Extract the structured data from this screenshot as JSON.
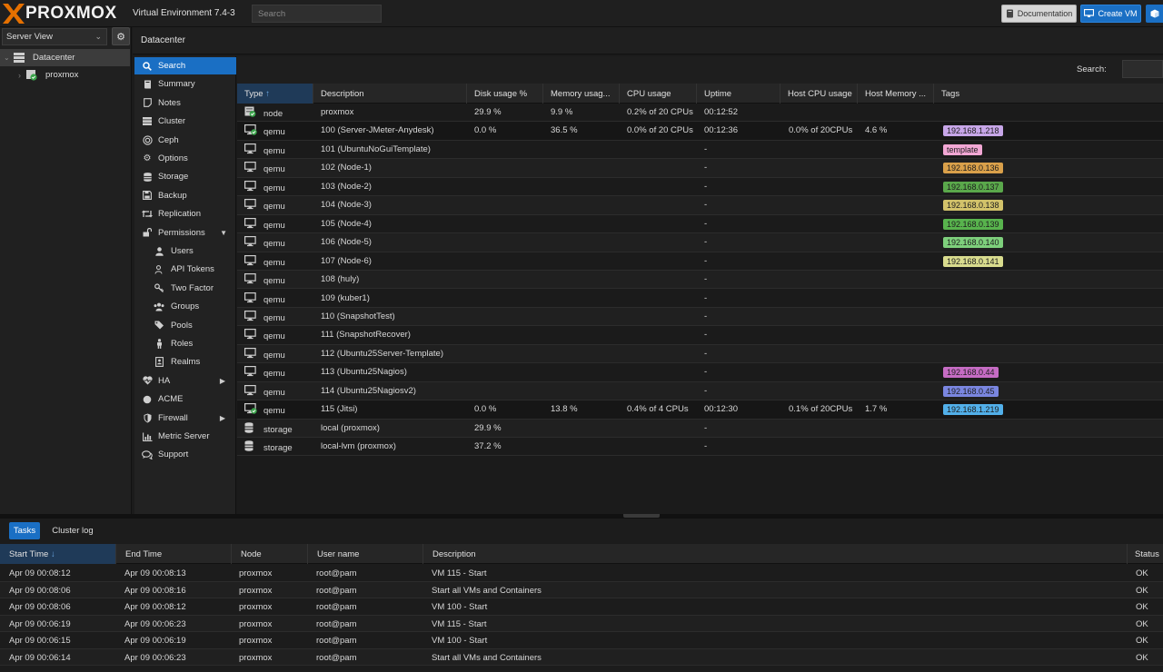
{
  "topbar": {
    "logo": "PROXMOX",
    "version": "Virtual Environment 7.4-3",
    "search_placeholder": "Search",
    "documentation_label": "Documentation",
    "create_vm_label": "Create VM"
  },
  "tree": {
    "view_label": "Server View",
    "items": [
      {
        "label": "Datacenter",
        "icon": "datacenter-icon"
      },
      {
        "label": "proxmox",
        "icon": "node-online-icon"
      }
    ]
  },
  "content_header": {
    "title": "Datacenter"
  },
  "nav": {
    "items": [
      {
        "label": "Search",
        "icon": "search-icon",
        "active": true
      },
      {
        "label": "Summary",
        "icon": "book-icon"
      },
      {
        "label": "Notes",
        "icon": "note-icon"
      },
      {
        "label": "Cluster",
        "icon": "server-icon"
      },
      {
        "label": "Ceph",
        "icon": "ceph-icon"
      },
      {
        "label": "Options",
        "icon": "gear-icon"
      },
      {
        "label": "Storage",
        "icon": "database-icon"
      },
      {
        "label": "Backup",
        "icon": "floppy-icon"
      },
      {
        "label": "Replication",
        "icon": "retweet-icon"
      },
      {
        "label": "Permissions",
        "icon": "unlock-icon",
        "expanded": true
      },
      {
        "label": "Users",
        "icon": "user-icon",
        "sub": true
      },
      {
        "label": "API Tokens",
        "icon": "user-tag-icon",
        "sub": true
      },
      {
        "label": "Two Factor",
        "icon": "key-icon",
        "sub": true
      },
      {
        "label": "Groups",
        "icon": "users-icon",
        "sub": true
      },
      {
        "label": "Pools",
        "icon": "tags-icon",
        "sub": true
      },
      {
        "label": "Roles",
        "icon": "male-icon",
        "sub": true
      },
      {
        "label": "Realms",
        "icon": "address-book-icon",
        "sub": true
      },
      {
        "label": "HA",
        "icon": "heartbeat-icon",
        "collapsed": true
      },
      {
        "label": "ACME",
        "icon": "certificate-icon"
      },
      {
        "label": "Firewall",
        "icon": "shield-icon",
        "collapsed": true
      },
      {
        "label": "Metric Server",
        "icon": "bar-chart-icon"
      },
      {
        "label": "Support",
        "icon": "comments-icon"
      }
    ]
  },
  "grid": {
    "search_label": "Search:",
    "columns": [
      "Type",
      "Description",
      "Disk usage %",
      "Memory usag...",
      "CPU usage",
      "Uptime",
      "Host CPU usage",
      "Host Memory ...",
      "Tags"
    ],
    "rows": [
      {
        "icon": "node-online-icon",
        "type": "node",
        "desc": "proxmox",
        "disk": "29.9 %",
        "mem": "9.9 %",
        "cpu": "0.2% of 20 CPUs",
        "uptime": "00:12:52",
        "hostcpu": "",
        "hostmem": "",
        "tag": ""
      },
      {
        "icon": "vm-running-icon",
        "type": "qemu",
        "desc": "100 (Server-JMeter-Anydesk)",
        "disk": "0.0 %",
        "mem": "36.5 %",
        "cpu": "0.0% of 20 CPUs",
        "uptime": "00:12:36",
        "hostcpu": "0.0% of 20CPUs",
        "hostmem": "4.6 %",
        "tag": "192.168.1.218",
        "tag_color": "#c7a6e8",
        "highlight": true
      },
      {
        "icon": "vm-icon",
        "type": "qemu",
        "desc": "101 (UbuntuNoGuiTemplate)",
        "disk": "",
        "mem": "",
        "cpu": "",
        "uptime": "-",
        "hostcpu": "",
        "hostmem": "",
        "tag": "template",
        "tag_color": "#f2a7d4"
      },
      {
        "icon": "vm-icon",
        "type": "qemu",
        "desc": "102 (Node-1)",
        "disk": "",
        "mem": "",
        "cpu": "",
        "uptime": "-",
        "hostcpu": "",
        "hostmem": "",
        "tag": "192.168.0.136",
        "tag_color": "#d9a04a"
      },
      {
        "icon": "vm-icon",
        "type": "qemu",
        "desc": "103 (Node-2)",
        "disk": "",
        "mem": "",
        "cpu": "",
        "uptime": "-",
        "hostcpu": "",
        "hostmem": "",
        "tag": "192.168.0.137",
        "tag_color": "#5aa84b"
      },
      {
        "icon": "vm-icon",
        "type": "qemu",
        "desc": "104 (Node-3)",
        "disk": "",
        "mem": "",
        "cpu": "",
        "uptime": "-",
        "hostcpu": "",
        "hostmem": "",
        "tag": "192.168.0.138",
        "tag_color": "#d2c26a"
      },
      {
        "icon": "vm-icon",
        "type": "qemu",
        "desc": "105 (Node-4)",
        "disk": "",
        "mem": "",
        "cpu": "",
        "uptime": "-",
        "hostcpu": "",
        "hostmem": "",
        "tag": "192.168.0.139",
        "tag_color": "#58b34d"
      },
      {
        "icon": "vm-icon",
        "type": "qemu",
        "desc": "106 (Node-5)",
        "disk": "",
        "mem": "",
        "cpu": "",
        "uptime": "-",
        "hostcpu": "",
        "hostmem": "",
        "tag": "192.168.0.140",
        "tag_color": "#7ed07c"
      },
      {
        "icon": "vm-icon",
        "type": "qemu",
        "desc": "107 (Node-6)",
        "disk": "",
        "mem": "",
        "cpu": "",
        "uptime": "-",
        "hostcpu": "",
        "hostmem": "",
        "tag": "192.168.0.141",
        "tag_color": "#d9dc8e"
      },
      {
        "icon": "vm-icon",
        "type": "qemu",
        "desc": "108 (huly)",
        "disk": "",
        "mem": "",
        "cpu": "",
        "uptime": "-",
        "hostcpu": "",
        "hostmem": "",
        "tag": ""
      },
      {
        "icon": "vm-icon",
        "type": "qemu",
        "desc": "109 (kuber1)",
        "disk": "",
        "mem": "",
        "cpu": "",
        "uptime": "-",
        "hostcpu": "",
        "hostmem": "",
        "tag": ""
      },
      {
        "icon": "vm-icon",
        "type": "qemu",
        "desc": "110 (SnapshotTest)",
        "disk": "",
        "mem": "",
        "cpu": "",
        "uptime": "-",
        "hostcpu": "",
        "hostmem": "",
        "tag": ""
      },
      {
        "icon": "vm-icon",
        "type": "qemu",
        "desc": "111 (SnapshotRecover)",
        "disk": "",
        "mem": "",
        "cpu": "",
        "uptime": "-",
        "hostcpu": "",
        "hostmem": "",
        "tag": ""
      },
      {
        "icon": "vm-icon",
        "type": "qemu",
        "desc": "112 (Ubuntu25Server-Template)",
        "disk": "",
        "mem": "",
        "cpu": "",
        "uptime": "-",
        "hostcpu": "",
        "hostmem": "",
        "tag": ""
      },
      {
        "icon": "vm-icon",
        "type": "qemu",
        "desc": "113 (Ubuntu25Nagios)",
        "disk": "",
        "mem": "",
        "cpu": "",
        "uptime": "-",
        "hostcpu": "",
        "hostmem": "",
        "tag": "192.168.0.44",
        "tag_color": "#c66cc4"
      },
      {
        "icon": "vm-icon",
        "type": "qemu",
        "desc": "114 (Ubuntu25Nagiosv2)",
        "disk": "",
        "mem": "",
        "cpu": "",
        "uptime": "-",
        "hostcpu": "",
        "hostmem": "",
        "tag": "192.168.0.45",
        "tag_color": "#7a86e0"
      },
      {
        "icon": "vm-running-icon",
        "type": "qemu",
        "desc": "115 (Jitsi)",
        "disk": "0.0 %",
        "mem": "13.8 %",
        "cpu": "0.4% of 4 CPUs",
        "uptime": "00:12:30",
        "hostcpu": "0.1% of 20CPUs",
        "hostmem": "1.7 %",
        "tag": "192.168.1.219",
        "tag_color": "#52b0ea",
        "highlight": true
      },
      {
        "icon": "storage-icon",
        "type": "storage",
        "desc": "local (proxmox)",
        "disk": "29.9 %",
        "mem": "",
        "cpu": "",
        "uptime": "-",
        "hostcpu": "",
        "hostmem": "",
        "tag": ""
      },
      {
        "icon": "storage-icon",
        "type": "storage",
        "desc": "local-lvm (proxmox)",
        "disk": "37.2 %",
        "mem": "",
        "cpu": "",
        "uptime": "-",
        "hostcpu": "",
        "hostmem": "",
        "tag": ""
      }
    ]
  },
  "tasks": {
    "tabs": [
      "Tasks",
      "Cluster log"
    ],
    "columns": [
      "Start Time",
      "End Time",
      "Node",
      "User name",
      "Description",
      "Status"
    ],
    "rows": [
      {
        "start": "Apr 09 00:08:12",
        "end": "Apr 09 00:08:13",
        "node": "proxmox",
        "user": "root@pam",
        "desc": "VM 115 - Start",
        "status": "OK"
      },
      {
        "start": "Apr 09 00:08:06",
        "end": "Apr 09 00:08:16",
        "node": "proxmox",
        "user": "root@pam",
        "desc": "Start all VMs and Containers",
        "status": "OK"
      },
      {
        "start": "Apr 09 00:08:06",
        "end": "Apr 09 00:08:12",
        "node": "proxmox",
        "user": "root@pam",
        "desc": "VM 100 - Start",
        "status": "OK"
      },
      {
        "start": "Apr 09 00:06:19",
        "end": "Apr 09 00:06:23",
        "node": "proxmox",
        "user": "root@pam",
        "desc": "VM 115 - Start",
        "status": "OK"
      },
      {
        "start": "Apr 09 00:06:15",
        "end": "Apr 09 00:06:19",
        "node": "proxmox",
        "user": "root@pam",
        "desc": "VM 100 - Start",
        "status": "OK"
      },
      {
        "start": "Apr 09 00:06:14",
        "end": "Apr 09 00:06:23",
        "node": "proxmox",
        "user": "root@pam",
        "desc": "Start all VMs and Containers",
        "status": "OK"
      }
    ]
  }
}
